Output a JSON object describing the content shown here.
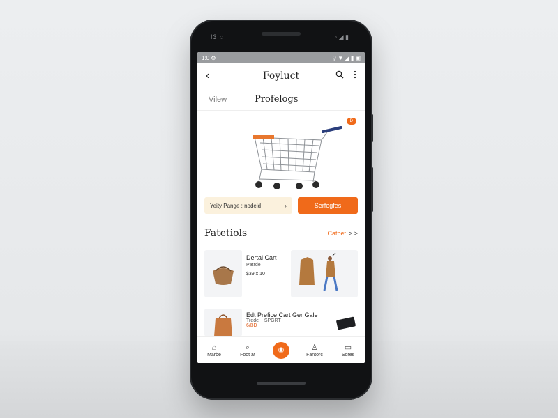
{
  "status_bar": {
    "left": "1:0 ⚙",
    "right": "⚲ ▼ ◢ ▮ ▣"
  },
  "phone_sensors": {
    "left": "!3  ○",
    "right": "◦ ◢ ▮"
  },
  "appbar": {
    "back_icon": "‹",
    "title": "Foyluct",
    "search_icon": "⌕",
    "more_icon": "⋮"
  },
  "tabs": [
    {
      "label": "Vilew"
    },
    {
      "label": "Profelogs"
    }
  ],
  "hero": {
    "badge": "D"
  },
  "promo": {
    "text": "Yeity Pange : nodeid",
    "chevron": "›"
  },
  "cta": {
    "label": "Serfegfes"
  },
  "section": {
    "title": "Fatetiols",
    "link": "Catbet",
    "chevrons": "> >"
  },
  "items": [
    {
      "name": "Dertal Cart",
      "sub": "Patrde",
      "price": "$39 x 10"
    }
  ],
  "items2": [
    {
      "name": "Edt Prefice Cart Ger Gale",
      "sub": "Trede",
      "price": "6/BD",
      "extra": "SPGRT"
    }
  ],
  "bottom_nav": [
    {
      "icon": "⌂",
      "label": "Marbe"
    },
    {
      "icon": "⌕",
      "label": "Foot at"
    },
    {
      "icon": "◉",
      "label": ""
    },
    {
      "icon": "♙",
      "label": "Fantorc"
    },
    {
      "icon": "▭",
      "label": "Sores"
    }
  ],
  "colors": {
    "accent": "#f06a1a",
    "promo_bg": "#fbf1dd",
    "status_bar": "#9a9c9f"
  }
}
